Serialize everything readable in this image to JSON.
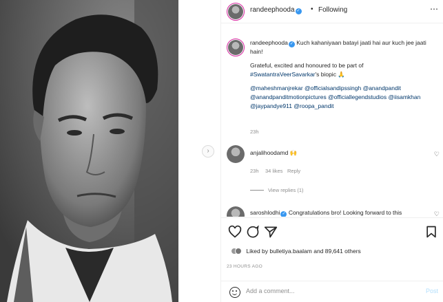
{
  "header": {
    "username": "randeephooda",
    "separator": "•",
    "follow_label": "Following",
    "more_icon": "more-icon"
  },
  "caption": {
    "username": "randeephooda",
    "line1": "Kuch kahaniyaan batayi jaati hai aur kuch jee jaati hain!",
    "line2_text": "Grateful, excited and honoured to be part of",
    "hashtag": "#SwatantraVeerSavarkar",
    "line2_suffix": "'s biopic",
    "emoji": "🙏",
    "mentions": "@maheshmanjrekar @officialsandipssingh @anandpandit @anandpanditmotionpictures @officiallegendstudios @iisamkhan @jaypandye911 @roopa_pandit",
    "time": "23h"
  },
  "comment1": {
    "username": "anjalihoodamd",
    "text": "🙌",
    "time": "23h",
    "likes": "34 likes",
    "reply": "Reply",
    "view_replies": "View replies (1)"
  },
  "comment2": {
    "username": "saroshlodhi",
    "text": "Congratulations bro! Looking forward to this"
  },
  "likes": {
    "prefix": "Liked by",
    "user": "bulletiya.baalam",
    "middle": "and",
    "count": "89,641 others"
  },
  "timestamp": "23 HOURS AGO",
  "add_comment": {
    "placeholder": "Add a comment...",
    "post_label": "Post"
  },
  "nav": {
    "arrow_glyph": "›"
  }
}
